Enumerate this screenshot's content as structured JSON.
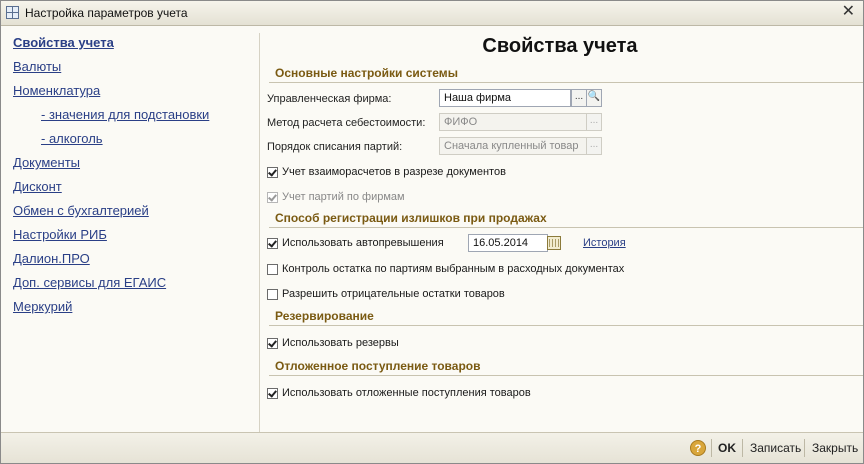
{
  "window": {
    "title": "Настройка параметров учета",
    "close_label": "✕"
  },
  "nav": {
    "items": [
      {
        "label": "Свойства учета"
      },
      {
        "label": "Валюты"
      },
      {
        "label": "Номенклатура"
      },
      {
        "label": "- значения для подстановки"
      },
      {
        "label": "- алкоголь"
      },
      {
        "label": "Документы"
      },
      {
        "label": "Дисконт"
      },
      {
        "label": "Обмен с бухгалтерией"
      },
      {
        "label": "Настройки РИБ"
      },
      {
        "label": "Далион.ПРО"
      },
      {
        "label": "Доп. сервисы для ЕГАИС"
      },
      {
        "label": "Меркурий"
      }
    ]
  },
  "main": {
    "title": "Свойства учета",
    "sections": {
      "basic": "Основные настройки системы",
      "surplus": "Способ регистрации излишков при продажах",
      "reserve": "Резервирование",
      "deferred": "Отложенное поступление товаров"
    },
    "firm": {
      "label": "Управленческая фирма:",
      "value": "Наша фирма",
      "select_label": "...",
      "search_label": "🔍"
    },
    "cost_method": {
      "label": "Метод расчета себестоимости:",
      "value": "ФИФО",
      "select_label": "..."
    },
    "write_off": {
      "label": "Порядок списания партий:",
      "value": "Сначала купленный товар",
      "select_label": "..."
    },
    "checkboxes": {
      "settlements": "Учет взаиморасчетов в разрезе документов",
      "batches_by_firm": "Учет партий по фирмам",
      "auto_surplus": "Использовать автопревышения",
      "batch_control": "Контроль остатка по партиям выбранным в расходных документах",
      "negative": "Разрешить отрицательные остатки товаров",
      "use_reserves": "Использовать резервы",
      "use_deferred": "Использовать отложенные поступления товаров"
    },
    "auto_surplus_date": "16.05.2014",
    "history_label": "История"
  },
  "footer": {
    "help_label": "?",
    "ok_label": "OK",
    "save_label": "Записать",
    "close_label": "Закрыть"
  },
  "colors": {
    "link": "#2a3f86",
    "section_header": "#7a5a12",
    "help_badge": "#d9a63b"
  }
}
